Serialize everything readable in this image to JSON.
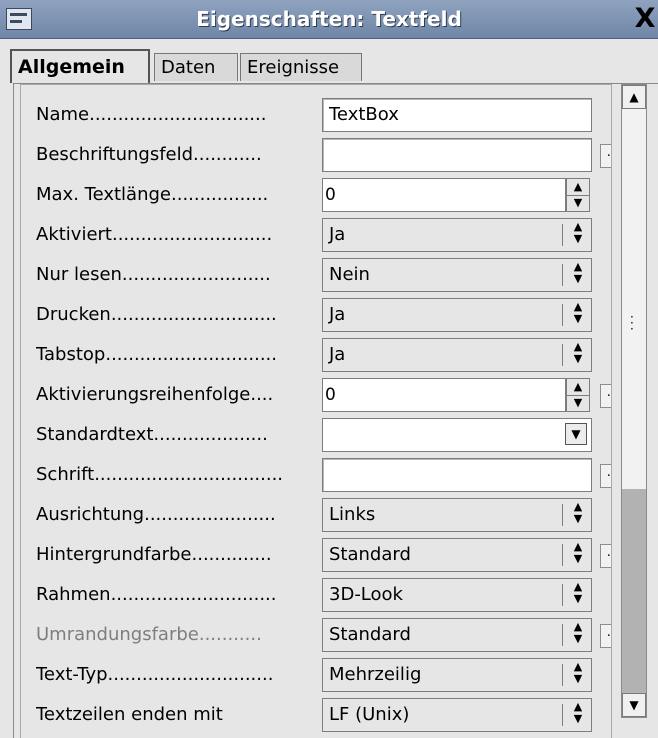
{
  "window": {
    "title": "Eigenschaften: Textfeld",
    "close": "X"
  },
  "tabs": [
    "Allgemein",
    "Daten",
    "Ereignisse"
  ],
  "rows": {
    "name": {
      "label": "Name...............................",
      "value": "TextBox"
    },
    "beschriftungsfeld": {
      "label": "Beschriftungsfeld............",
      "value": ""
    },
    "maxtextlaenge": {
      "label": "Max. Textlänge.................",
      "value": "0"
    },
    "aktiviert": {
      "label": "Aktiviert............................",
      "value": "Ja"
    },
    "nurlesen": {
      "label": "Nur lesen..........................",
      "value": "Nein"
    },
    "drucken": {
      "label": "Drucken.............................",
      "value": "Ja"
    },
    "tabstop": {
      "label": "Tabstop..............................",
      "value": "Ja"
    },
    "aktivierungsreihenfolge": {
      "label": "Aktivierungsreihenfolge....",
      "value": "0"
    },
    "standardtext": {
      "label": "Standardtext....................",
      "value": ""
    },
    "schrift": {
      "label": "Schrift.................................",
      "value": ""
    },
    "ausrichtung": {
      "label": "Ausrichtung.......................",
      "value": "Links"
    },
    "hintergrundfarbe": {
      "label": "Hintergrundfarbe..............",
      "value": "Standard"
    },
    "rahmen": {
      "label": "Rahmen.............................",
      "value": "3D-Look"
    },
    "umrandungsfarbe": {
      "label": "Umrandungsfarbe...........",
      "value": "Standard"
    },
    "texttyp": {
      "label": "Text-Typ.............................",
      "value": "Mehrzeilig"
    },
    "textzeilen": {
      "label": "Textzeilen enden mit",
      "value": "LF (Unix)"
    }
  },
  "buttons": {
    "ellipsis": "..."
  },
  "icons": {
    "spin_up": "▲",
    "spin_down": "▼",
    "dropdown": "▼",
    "scroll_up": "▲",
    "scroll_down": "▼",
    "grip": "⋮"
  }
}
